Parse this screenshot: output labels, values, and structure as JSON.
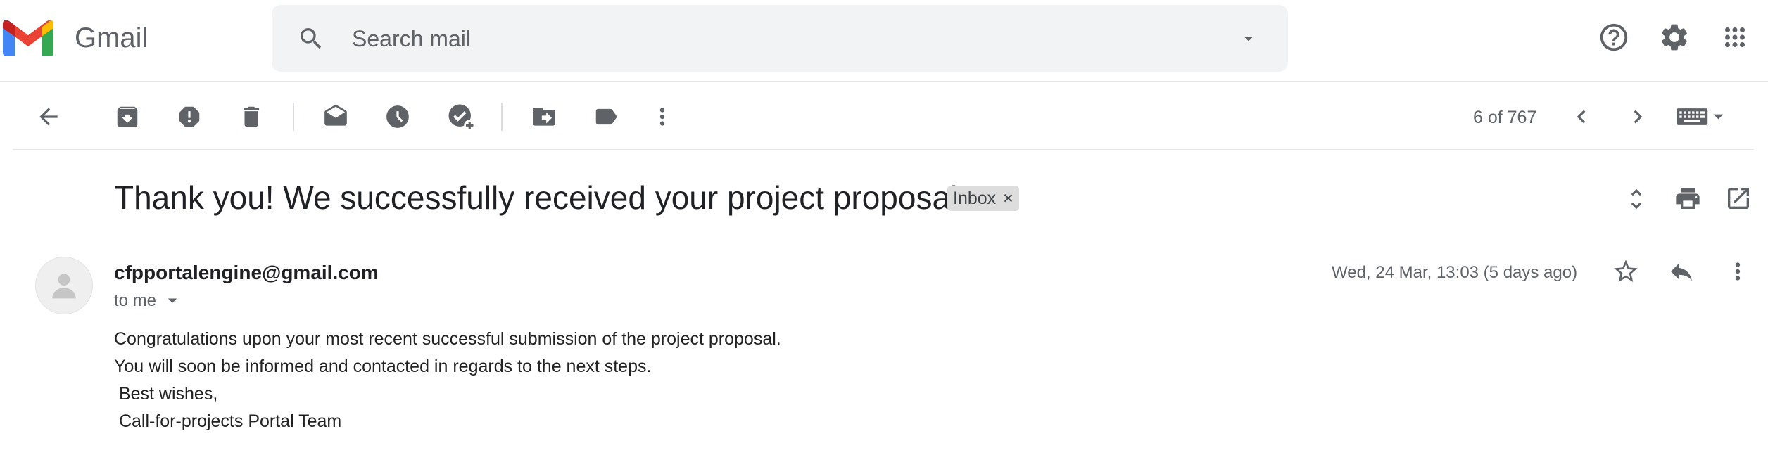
{
  "header": {
    "app_name": "Gmail",
    "search_placeholder": "Search mail"
  },
  "toolbar": {
    "pager": "6 of 767"
  },
  "email": {
    "subject": "Thank you! We successfully received your project proposal!",
    "label": "Inbox",
    "label_remove": "×",
    "sender": "cfpportalengine@gmail.com",
    "recipient": "to me",
    "date": "Wed, 24 Mar, 13:03 (5 days ago)",
    "body": [
      "Congratulations upon your most recent successful submission of the project proposal.",
      "You will soon be informed and contacted in regards to the next steps.",
      " Best wishes,",
      " Call-for-projects Portal Team"
    ]
  },
  "colors": {
    "gmail_red": "#EA4335",
    "gmail_blue": "#4285F4",
    "gmail_green": "#34A853",
    "gmail_yellow": "#FBBC04",
    "icon_grey": "#5f6368"
  }
}
